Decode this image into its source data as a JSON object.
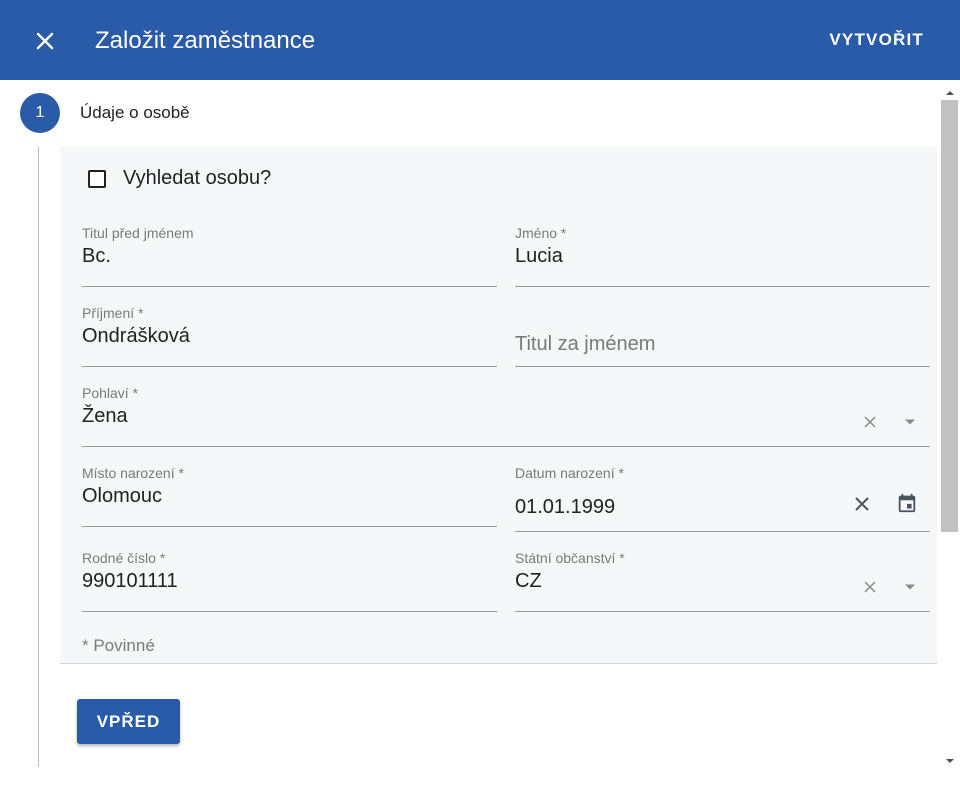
{
  "header": {
    "title": "Založit zaměstnance",
    "create_label": "VYTVOŘIT",
    "close_icon": "close-icon",
    "background_color": "#2a5ba8"
  },
  "stepper": {
    "step_number": "1",
    "step_label": "Údaje o osobě"
  },
  "search_person": {
    "label": "Vyhledat osobu?",
    "checked": false
  },
  "fields": {
    "title_before": {
      "label": "Titul před jménem",
      "value": "Bc."
    },
    "first_name": {
      "label": "Jméno *",
      "value": "Lucia"
    },
    "last_name": {
      "label": "Příjmení *",
      "value": "Ondrášková"
    },
    "title_after": {
      "placeholder": "Titul za jménem"
    },
    "gender": {
      "label": "Pohlaví *",
      "value": "Žena"
    },
    "birth_place": {
      "label": "Místo narození *",
      "value": "Olomouc"
    },
    "birth_date": {
      "label": "Datum narození *",
      "value": "01.01.1999"
    },
    "birth_number": {
      "label": "Rodné číslo *",
      "value": "990101111"
    },
    "citizenship": {
      "label": "Státní občanství *",
      "value": "CZ"
    }
  },
  "required_note": "* Povinné",
  "next_label": "VPŘED",
  "icons": [
    "close-icon",
    "clear-icon",
    "chevron-down-icon",
    "calendar-icon"
  ]
}
